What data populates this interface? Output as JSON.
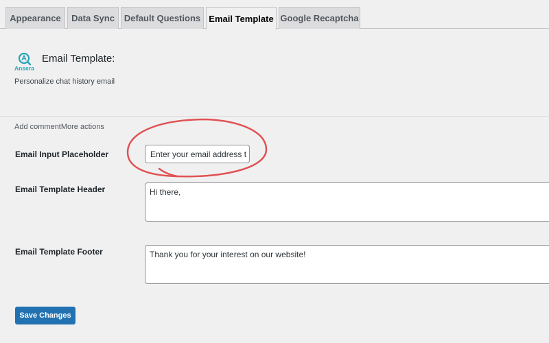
{
  "tabs": [
    {
      "label": "Appearance"
    },
    {
      "label": "Data Sync"
    },
    {
      "label": "Default Questions"
    },
    {
      "label": "Email Template",
      "active": true
    },
    {
      "label": "Google Recaptcha"
    }
  ],
  "logo": {
    "text": "Ansera",
    "brand_color": "#2aa3b6"
  },
  "section": {
    "title": "Email Template:",
    "description": "Personalize chat history email",
    "stray_text": "Add commentMore actions"
  },
  "form": {
    "placeholder_label": "Email Input Placeholder",
    "placeholder_value": "Enter your email address t",
    "header_label": "Email Template Header",
    "header_value": "Hi there,",
    "footer_label": "Email Template Footer",
    "footer_value": "Thank you for your interest on our website!"
  },
  "actions": {
    "save_label": "Save Changes"
  },
  "colors": {
    "accent": "#2271b1",
    "annotation": "#e05252",
    "background": "#f0f0f1"
  }
}
